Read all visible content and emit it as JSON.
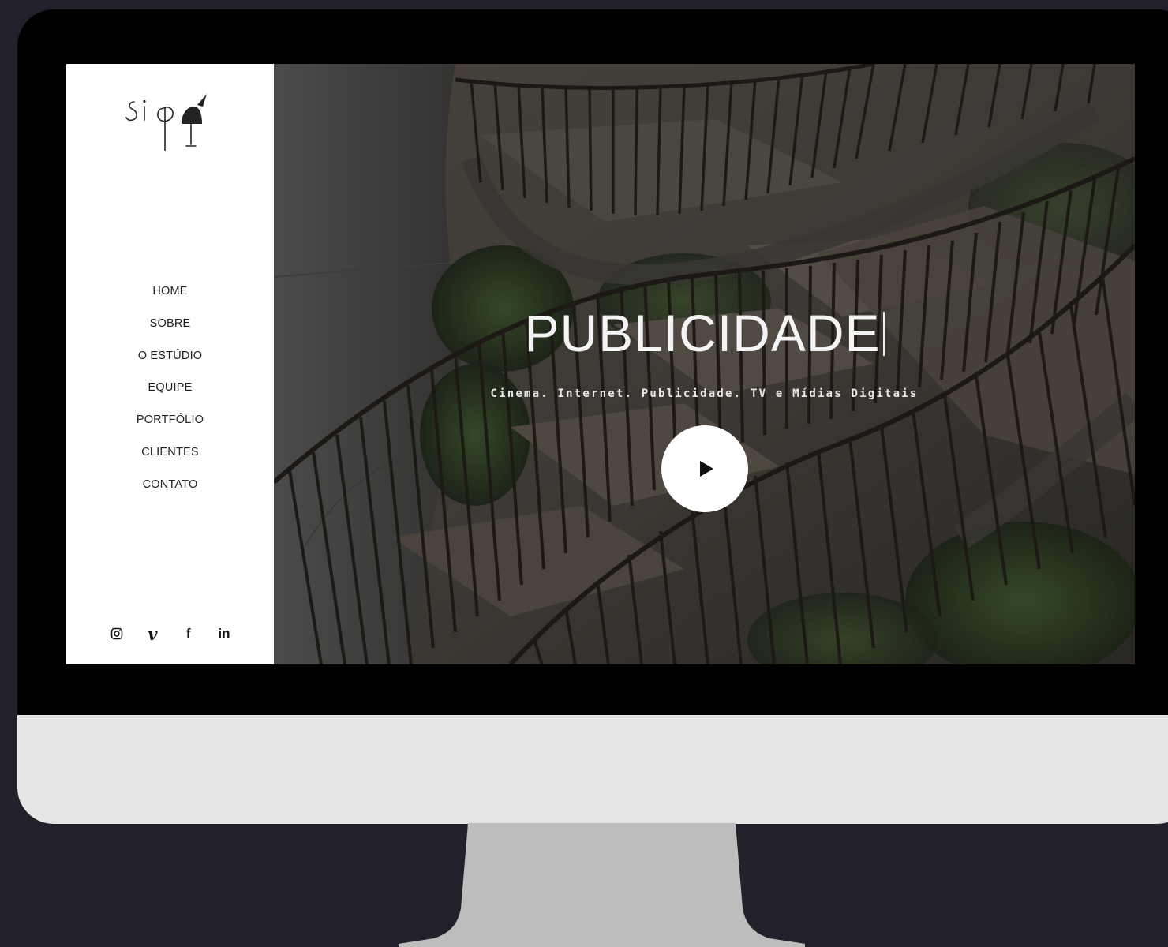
{
  "sidebar": {
    "logo_text": "sipa",
    "nav": [
      {
        "label": "HOME"
      },
      {
        "label": "SOBRE"
      },
      {
        "label": "O ESTÚDIO"
      },
      {
        "label": "EQUIPE"
      },
      {
        "label": "PORTFÓLIO"
      },
      {
        "label": "CLIENTES"
      },
      {
        "label": "CONTATO"
      }
    ],
    "social": {
      "vimeo_glyph": "v",
      "facebook_glyph": "f",
      "linkedin_glyph": "in"
    }
  },
  "hero": {
    "title": "PUBLICIDADE",
    "subtitle": "Cinema. Internet. Publicidade. TV e Mídias Digitais"
  },
  "icons": [
    "instagram-icon",
    "vimeo-icon",
    "facebook-icon",
    "linkedin-icon",
    "play-icon"
  ],
  "colors": {
    "background": "#21212b",
    "bezel": "#000000",
    "chin": "#e6e6e6",
    "stand": "#bdbdbd",
    "sidebar": "#ffffff"
  }
}
